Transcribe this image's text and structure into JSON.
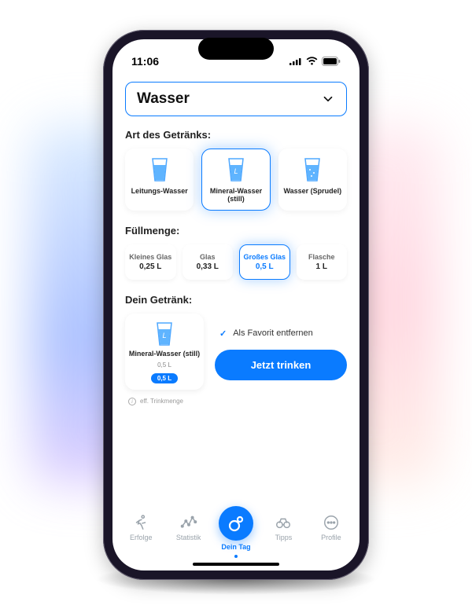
{
  "statusbar": {
    "time": "11:06"
  },
  "dropdown": {
    "label": "Wasser"
  },
  "sections": {
    "type_title": "Art des Getränks:",
    "size_title": "Füllmenge:",
    "summary_title": "Dein Getränk:"
  },
  "types": [
    {
      "name": "Leitungs-Wasser",
      "selected": false
    },
    {
      "name": "Mineral-Wasser (still)",
      "selected": true
    },
    {
      "name": "Wasser (Sprudel)",
      "selected": false
    }
  ],
  "sizes": [
    {
      "name": "Kleines Glas",
      "volume": "0,25 L",
      "selected": false
    },
    {
      "name": "Glas",
      "volume": "0,33 L",
      "selected": false
    },
    {
      "name": "Großes Glas",
      "volume": "0,5 L",
      "selected": true
    },
    {
      "name": "Flasche",
      "volume": "1 L",
      "selected": false
    }
  ],
  "summary": {
    "name": "Mineral-Wasser (still)",
    "volume_text": "0,5 L",
    "pill": "0,5 L",
    "favorite_label": "Als Favorit entfernen",
    "cta": "Jetzt trinken",
    "footnote": "eff. Trinkmenge"
  },
  "tabs": [
    {
      "label": "Erfolge"
    },
    {
      "label": "Statistik"
    },
    {
      "label": "Dein Tag"
    },
    {
      "label": "Tipps"
    },
    {
      "label": "Profile"
    }
  ]
}
